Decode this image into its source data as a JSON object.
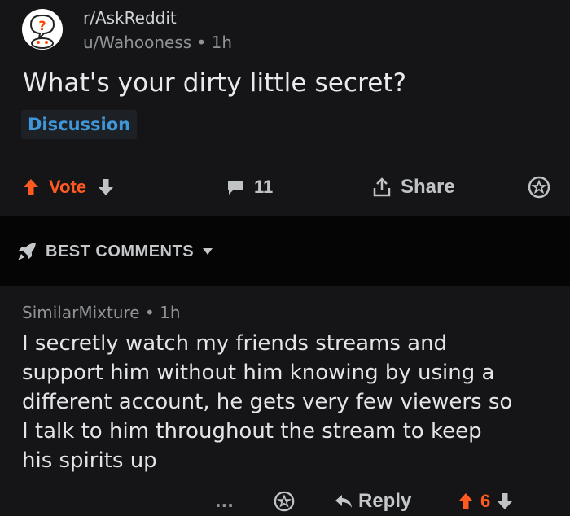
{
  "post": {
    "subreddit": "r/AskReddit",
    "author_meta": "u/Wahooness • 1h",
    "title": "What's your dirty little secret?",
    "flair": "Discussion",
    "vote_label": "Vote",
    "comment_count": "11",
    "share_label": "Share"
  },
  "sort": {
    "label": "BEST COMMENTS"
  },
  "comment": {
    "meta": "SimilarMixture • 1h",
    "body": "I secretly watch my friends streams and\nsupport him without him knowing by using a\ndifferent account, he gets very few viewers so\nI talk to him throughout the stream to keep\nhis spirits up",
    "more": "...",
    "reply_label": "Reply",
    "score": "6"
  },
  "colors": {
    "upvote": "#ff5a1f",
    "flair": "#3f96d8",
    "background": "#121214"
  },
  "icons": [
    "subreddit-avatar-icon",
    "upvote-icon",
    "downvote-icon",
    "comment-icon",
    "share-icon",
    "award-icon",
    "rocket-icon",
    "chevron-down-icon",
    "reply-icon",
    "more-icon"
  ]
}
